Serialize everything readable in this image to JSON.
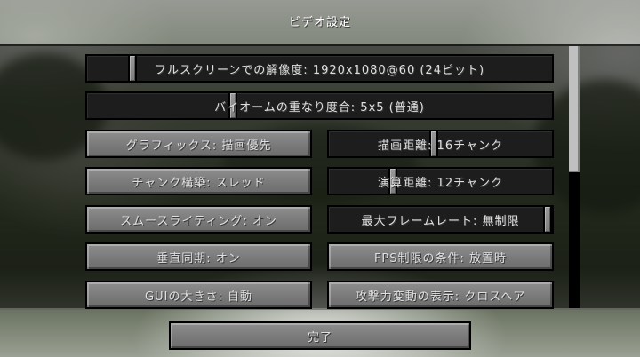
{
  "screen": {
    "title": "ビデオ設定"
  },
  "options": {
    "fullscreen_resolution": {
      "label": "フルスクリーンでの解像度: 1920x1080@60 (24ビット)",
      "value_fraction": 0.09
    },
    "biome_blend": {
      "label": "バイオームの重なり度合: 5x5 (普通)",
      "value_fraction": 0.31
    },
    "graphics": {
      "label": "グラフィックス: 描画優先"
    },
    "render_distance": {
      "label": "描画距離: 16チャンク",
      "value_fraction": 0.47
    },
    "chunk_builder": {
      "label": "チャンク構築: スレッド"
    },
    "simulation_distance": {
      "label": "演算距離: 12チャンク",
      "value_fraction": 0.28
    },
    "smooth_lighting": {
      "label": "スムースライティング: オン"
    },
    "max_framerate": {
      "label": "最大フレームレート: 無制限",
      "value_fraction": 1.0
    },
    "vsync": {
      "label": "垂直同期: オン"
    },
    "fps_limit_condition": {
      "label": "FPS制限の条件: 放置時"
    },
    "gui_scale": {
      "label": "GUIの大きさ: 自動"
    },
    "attack_indicator": {
      "label": "攻撃力変動の表示: クロスヘア"
    }
  },
  "footer": {
    "done_label": "完了"
  }
}
